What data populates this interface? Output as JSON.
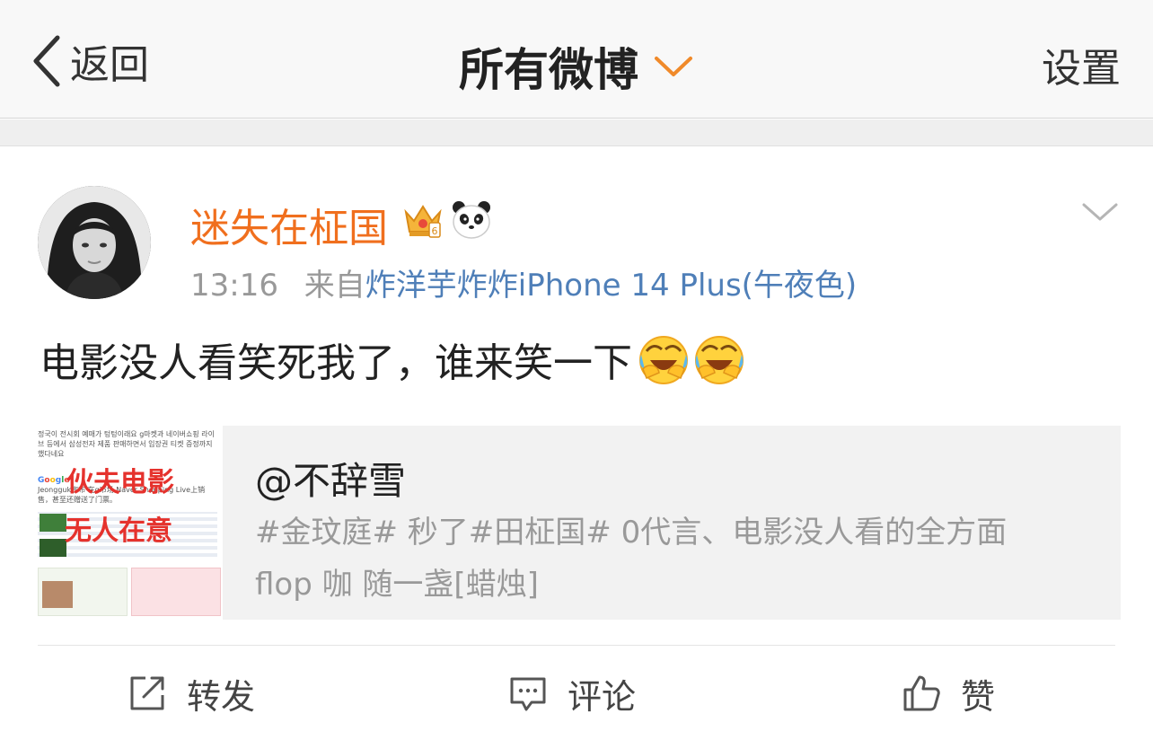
{
  "nav": {
    "back_label": "返回",
    "title": "所有微博",
    "settings_label": "设置"
  },
  "post": {
    "username": "迷失在柾国",
    "time": "13:16",
    "source_prefix": "来自",
    "source": "炸洋芋炸炸iPhone 14 Plus(午夜色)",
    "text": "电影没人看笑死我了，谁来笑一下",
    "emoji_count": 2
  },
  "quote": {
    "title": "@不辞雪",
    "description": "#金玟庭# 秒了#田柾国# 0代言、电影没人看的全方面flop 咖 随一盏[蜡烛]",
    "thumb_line1": "정국이 전시회 예매가 텅텅이래요 g마켓과 네이버쇼핑 라이브 등에서 삼성전자 제품 판매하면서 입장권 티켓 증정까지 했다네요",
    "thumb_line2": "Jeongguk宣布 在g市场 Naver Shopping Live上销售，甚至还赠送了门票。",
    "thumb_overlay1": "伙夫电影",
    "thumb_overlay2": "无人在意"
  },
  "actions": {
    "repost": "转发",
    "comment": "评论",
    "like": "赞"
  },
  "colors": {
    "username": "#f06f1e",
    "source_link": "#4f7fb8",
    "overlay_red": "#e5322d"
  }
}
